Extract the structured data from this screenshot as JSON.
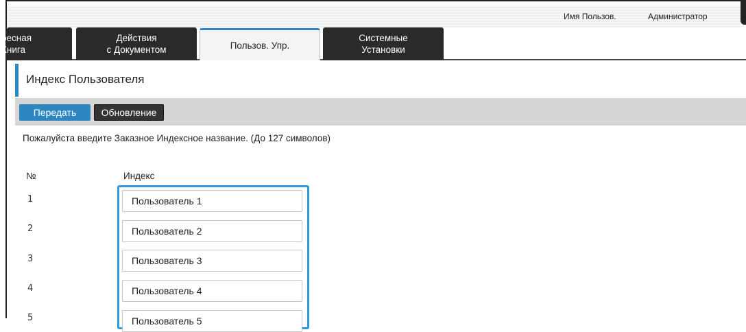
{
  "header": {
    "user_label": "Имя Пользов.",
    "user_value": "Администратор"
  },
  "tabs": [
    {
      "id": "address",
      "lines": [
        "ресная",
        "Книга"
      ]
    },
    {
      "id": "doc",
      "lines": [
        "Действия",
        "с Документом"
      ]
    },
    {
      "id": "user",
      "lines": [
        "Пользов. Упр."
      ],
      "active": true
    },
    {
      "id": "sys",
      "lines": [
        "Системные",
        "Установки"
      ]
    }
  ],
  "page": {
    "title": "Индекс Пользователя",
    "instructions": "Пожалуйста введите Заказное Индексное название. (До 127 символов)"
  },
  "toolbar": {
    "submit_label": "Передать",
    "update_label": "Обновление"
  },
  "table": {
    "col_no": "№",
    "col_index": "Индекс",
    "rows": [
      {
        "no": "1",
        "value": "Пользователь 1"
      },
      {
        "no": "2",
        "value": "Пользователь 2"
      },
      {
        "no": "3",
        "value": "Пользователь 3"
      },
      {
        "no": "4",
        "value": "Пользователь 4"
      },
      {
        "no": "5",
        "value": "Пользователь 5"
      }
    ]
  },
  "colors": {
    "accent": "#2e86c1",
    "focus": "#2e9ad8",
    "tab_dark": "#2a2a2a",
    "toolbar_bg": "#d6d6d6"
  }
}
